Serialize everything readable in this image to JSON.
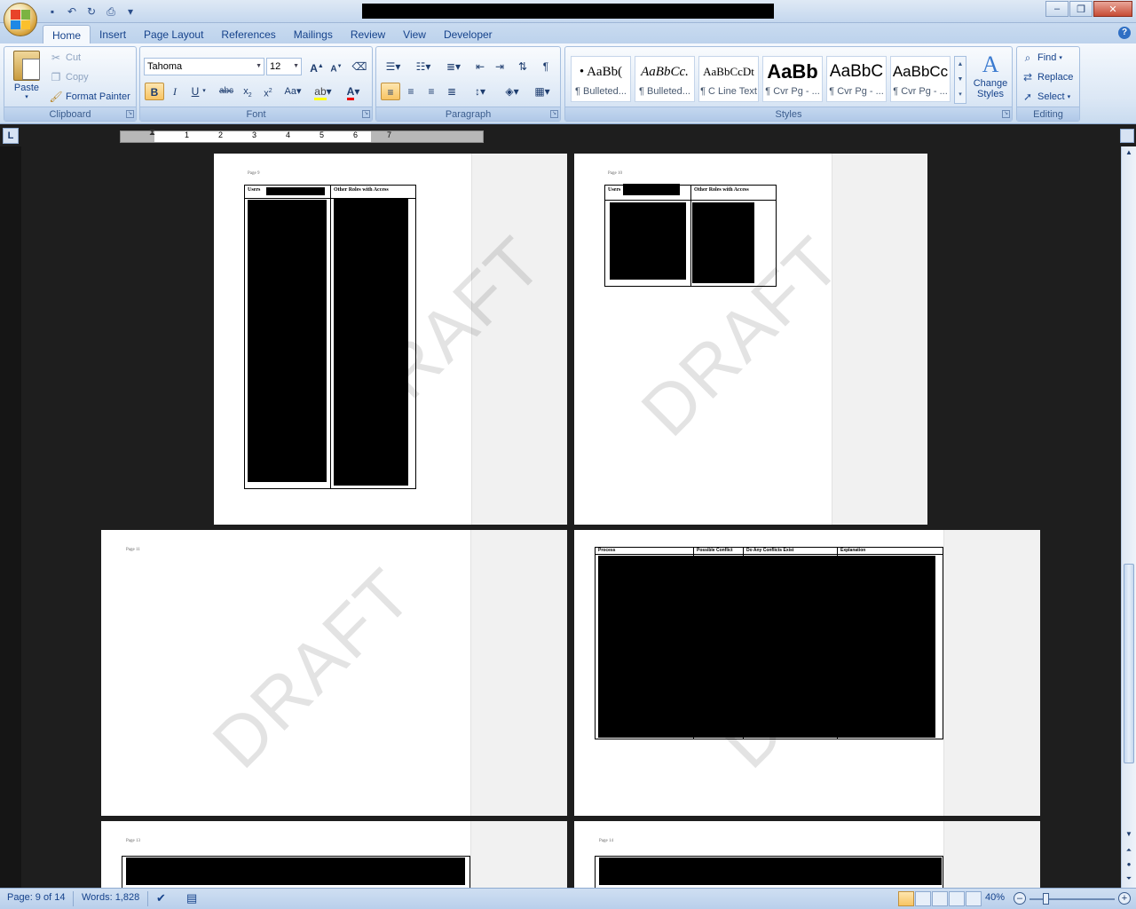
{
  "quick_access": {
    "save_icon": "save-icon",
    "undo_icon": "undo-icon",
    "redo_icon": "redo-icon",
    "print_preview_icon": "print-preview-icon",
    "customize_icon": "customize-qat-icon"
  },
  "tabs": [
    {
      "label": "Home",
      "active": true
    },
    {
      "label": "Insert"
    },
    {
      "label": "Page Layout"
    },
    {
      "label": "References"
    },
    {
      "label": "Mailings"
    },
    {
      "label": "Review"
    },
    {
      "label": "View"
    },
    {
      "label": "Developer"
    }
  ],
  "clipboard": {
    "label": "Clipboard",
    "paste": "Paste",
    "cut": "Cut",
    "copy": "Copy",
    "format_painter": "Format Painter"
  },
  "font": {
    "label": "Font",
    "name": "Tahoma",
    "size": "12"
  },
  "paragraph": {
    "label": "Paragraph"
  },
  "styles": {
    "label": "Styles",
    "change_styles": "Change Styles",
    "items": [
      {
        "sample": "• AaBb(",
        "name": "¶ Bulleted..."
      },
      {
        "sample": "AaBbCc.",
        "name": "¶ Bulleted..."
      },
      {
        "sample": "AaBbCcDt",
        "name": "¶ C Line Text"
      },
      {
        "sample": "AaBb",
        "name": "¶ Cvr Pg - ..."
      },
      {
        "sample": "AaBbC",
        "name": "¶ Cvr Pg - ..."
      },
      {
        "sample": "AaBbCc",
        "name": "¶ Cvr Pg - ..."
      }
    ]
  },
  "editing": {
    "label": "Editing",
    "find": "Find",
    "replace": "Replace",
    "select": "Select"
  },
  "ruler": {
    "numbers": [
      "1",
      "2",
      "3",
      "4",
      "5",
      "6",
      "7"
    ]
  },
  "pages": [
    {
      "label": "Page 9",
      "col1": "Users",
      "col2": "Other Roles with Access",
      "watermark": "DRAFT"
    },
    {
      "label": "Page 10",
      "col1": "Users",
      "col2": "Other Roles with Access",
      "watermark": "DRAFT"
    },
    {
      "label": "Page 11",
      "watermark": "DRAFT"
    },
    {
      "label": "",
      "cols": [
        "Process",
        "Possible Conflict",
        "Do Any Conflicts Exist",
        "Explanation"
      ],
      "watermark": "DRAFT"
    },
    {
      "label": "Page 13"
    },
    {
      "label": "Page 14"
    }
  ],
  "status": {
    "page": "Page: 9 of 14",
    "words": "Words: 1,828",
    "zoom": "40%"
  }
}
